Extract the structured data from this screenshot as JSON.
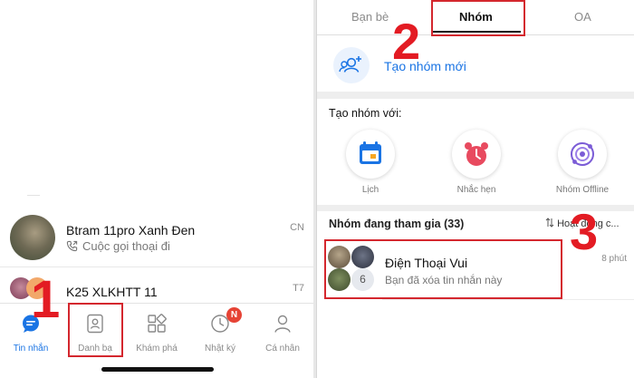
{
  "left": {
    "chats": [
      {
        "name": "Btram 11pro Xanh Đen",
        "time": "CN",
        "preview": "Cuộc gọi thoại đi"
      },
      {
        "name": "K25 XLKHTT 11",
        "time": "T7"
      }
    ],
    "tabs": [
      {
        "label": "Tin nhắn",
        "icon": "chat-bubble-icon"
      },
      {
        "label": "Danh bạ",
        "icon": "contacts-icon"
      },
      {
        "label": "Khám phá",
        "icon": "grid-icon"
      },
      {
        "label": "Nhật ký",
        "icon": "clock-icon",
        "badge": "N"
      },
      {
        "label": "Cá nhân",
        "icon": "person-icon"
      }
    ],
    "step_number": "1"
  },
  "right": {
    "tabs": [
      "Bạn bè",
      "Nhóm",
      "OA"
    ],
    "create_group": "Tạo nhóm mới",
    "create_with": "Tạo nhóm với:",
    "features": [
      {
        "label": "Lịch",
        "icon": "calendar-icon"
      },
      {
        "label": "Nhắc hẹn",
        "icon": "alarm-clock-icon"
      },
      {
        "label": "Nhóm Offline",
        "icon": "orbit-icon"
      }
    ],
    "joined_header": "Nhóm đang tham gia (33)",
    "sort_label": "Hoạt động c...",
    "group": {
      "name": "Điện Thoại Vui",
      "last_message": "Bạn đã xóa tin nhắn này",
      "time": "8 phút",
      "member_count": "6"
    },
    "step_two": "2",
    "step_three": "3"
  },
  "colors": {
    "accent": "#1a74e4",
    "highlight": "#d4272e",
    "badge": "#e64335"
  }
}
